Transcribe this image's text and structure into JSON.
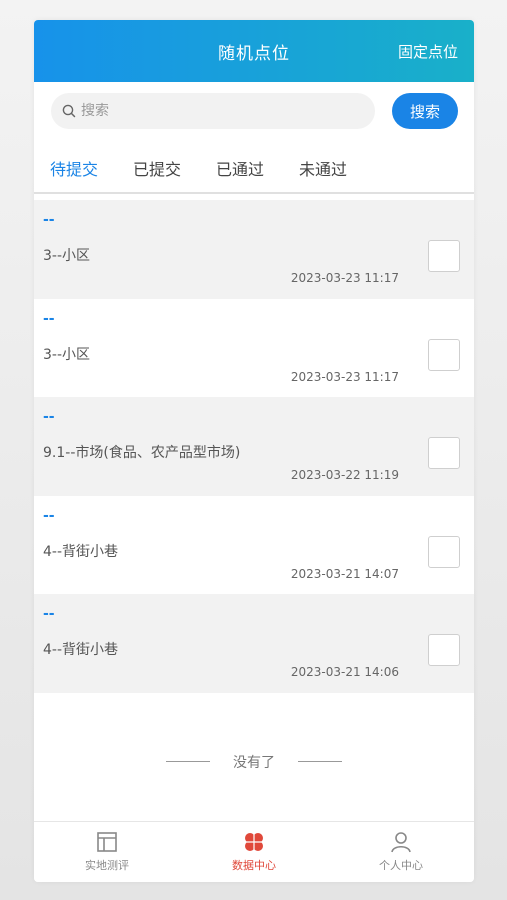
{
  "header": {
    "title": "随机点位",
    "right_link": "固定点位"
  },
  "search": {
    "placeholder": "搜索",
    "button_label": "搜索"
  },
  "tabs": [
    {
      "label": "待提交",
      "active": true
    },
    {
      "label": "已提交",
      "active": false
    },
    {
      "label": "已通过",
      "active": false
    },
    {
      "label": "未通过",
      "active": false
    }
  ],
  "items": [
    {
      "dash": "--",
      "name": "3--小区",
      "time": "2023-03-23 11:17",
      "checked": false
    },
    {
      "dash": "--",
      "name": "3--小区",
      "time": "2023-03-23 11:17",
      "checked": false
    },
    {
      "dash": "--",
      "name": "9.1--市场(食品、农产品型市场)",
      "time": "2023-03-22 11:19",
      "checked": false
    },
    {
      "dash": "--",
      "name": "4--背街小巷",
      "time": "2023-03-21 14:07",
      "checked": false
    },
    {
      "dash": "--",
      "name": "4--背街小巷",
      "time": "2023-03-21 14:06",
      "checked": false
    }
  ],
  "end_note": "没有了",
  "bottom_nav": [
    {
      "label": "实地测评",
      "icon": "layout-icon",
      "active": false
    },
    {
      "label": "数据中心",
      "icon": "data-center-icon",
      "active": true
    },
    {
      "label": "个人中心",
      "icon": "person-icon",
      "active": false
    }
  ],
  "colors": {
    "accent": "#1a84e6",
    "active_nav": "#e0483a",
    "header_start": "#1792ea",
    "header_end": "#19b0c9"
  }
}
